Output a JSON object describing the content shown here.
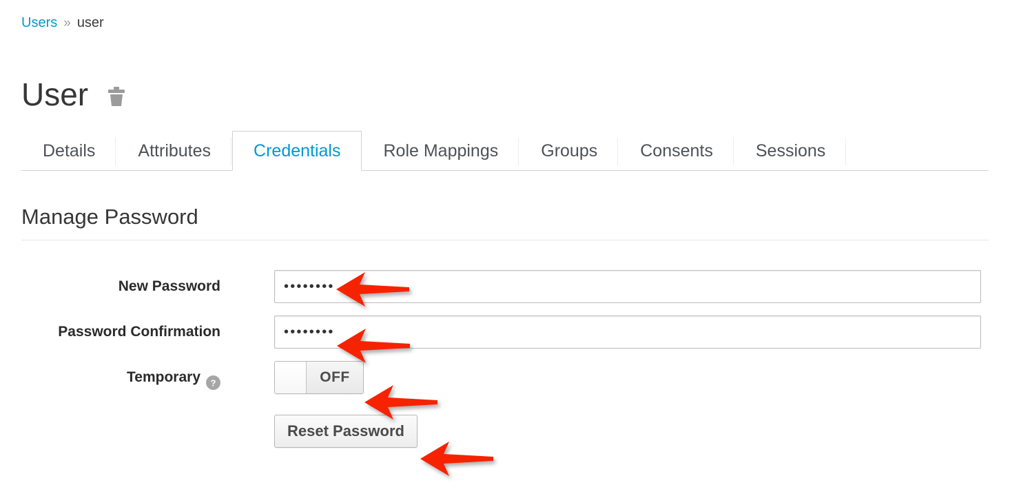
{
  "breadcrumb": {
    "parent": "Users",
    "separator": "»",
    "current": "user"
  },
  "header": {
    "title": "User",
    "delete_icon": "trash-icon"
  },
  "tabs": [
    {
      "label": "Details",
      "active": false
    },
    {
      "label": "Attributes",
      "active": false
    },
    {
      "label": "Credentials",
      "active": true
    },
    {
      "label": "Role Mappings",
      "active": false
    },
    {
      "label": "Groups",
      "active": false
    },
    {
      "label": "Consents",
      "active": false
    },
    {
      "label": "Sessions",
      "active": false
    }
  ],
  "section": {
    "heading": "Manage Password"
  },
  "form": {
    "new_password": {
      "label": "New Password",
      "value": "••••••••",
      "placeholder": ""
    },
    "password_confirmation": {
      "label": "Password Confirmation",
      "value": "••••••••",
      "placeholder": ""
    },
    "temporary": {
      "label": "Temporary",
      "help_icon": "question-circle-icon",
      "toggle_state": "OFF"
    },
    "reset_button": {
      "label": "Reset Password"
    }
  },
  "annotations": {
    "color": "#F62400",
    "arrows": [
      {
        "name": "arrow-new-password",
        "target": "new-password-input"
      },
      {
        "name": "arrow-password-confirmation",
        "target": "password-confirmation-input"
      },
      {
        "name": "arrow-temporary-toggle",
        "target": "temporary-toggle"
      },
      {
        "name": "arrow-reset-password",
        "target": "reset-password-button"
      }
    ]
  },
  "colors": {
    "link": "#0099d3",
    "active_tab": "#0099d3",
    "text": "#363636",
    "border": "#d1d1d1",
    "icon_gray": "#999999"
  }
}
